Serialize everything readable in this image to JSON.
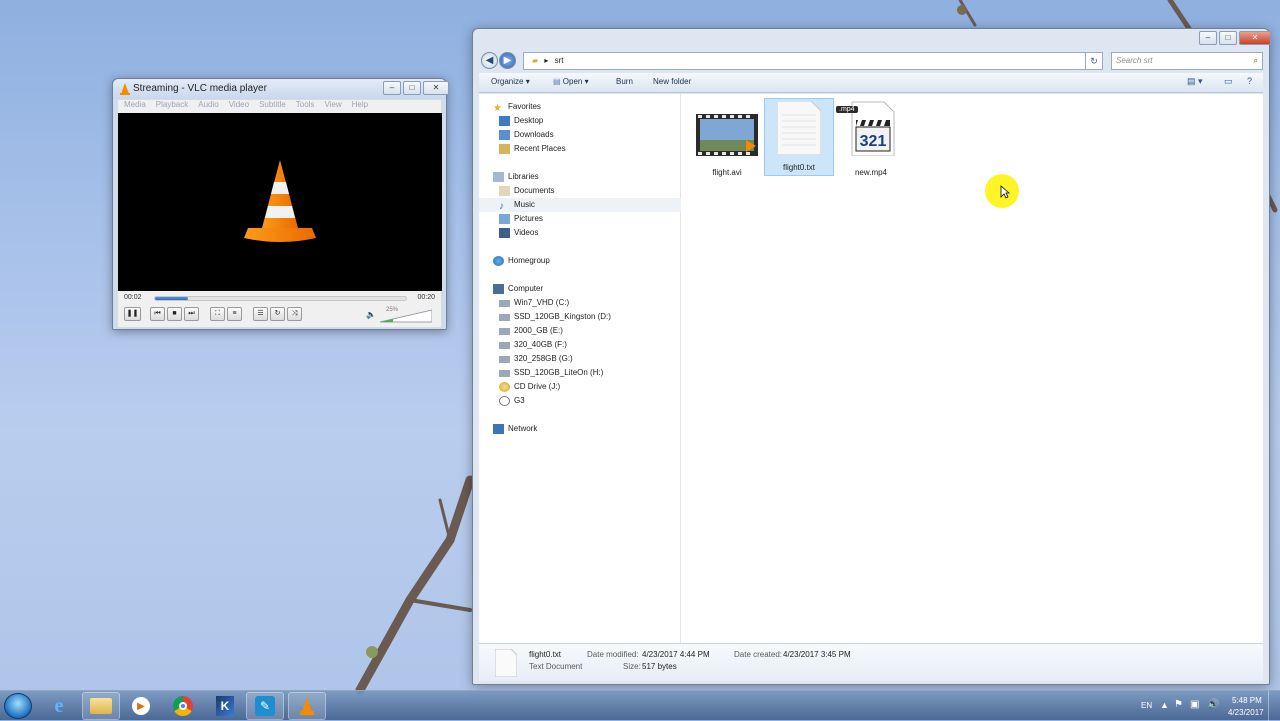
{
  "vlc": {
    "title": "Streaming - VLC media player",
    "menu": [
      "Media",
      "Playback",
      "Audio",
      "Video",
      "Subtitle",
      "Tools",
      "View",
      "Help"
    ],
    "elapsed": "00:02",
    "duration": "00:20",
    "progress": 0.13,
    "volume_label": "25%",
    "volume": 0.25
  },
  "explorer": {
    "breadcrumb": "srt",
    "search_placeholder": "Search srt",
    "toolbar": {
      "organize": "Organize",
      "open": "Open",
      "burn": "Burn",
      "new_folder": "New folder"
    },
    "nav": {
      "favorites": "Favorites",
      "favorites_items": [
        "Desktop",
        "Downloads",
        "Recent Places"
      ],
      "libraries": "Libraries",
      "libraries_items": [
        "Documents",
        "Music",
        "Pictures",
        "Videos"
      ],
      "homegroup": "Homegroup",
      "computer": "Computer",
      "computer_items": [
        "Win7_VHD (C:)",
        "SSD_120GB_Kingston (D:)",
        "2000_GB (E:)",
        "320_40GB (F:)",
        "320_258GB (G:)",
        "SSD_120GB_LiteOn (H:)",
        "CD Drive (J:)",
        "G3"
      ],
      "network": "Network"
    },
    "files": [
      {
        "name": "flight.avi",
        "icon": "video-thumbnail-icon"
      },
      {
        "name": "flight0.txt",
        "icon": "text-document-icon"
      },
      {
        "name": "new.mp4",
        "icon": "mp4-clapper-icon",
        "badge": ".mp4"
      }
    ],
    "details": {
      "name": "flight0.txt",
      "type": "Text Document",
      "modified_label": "Date modified:",
      "modified": "4/23/2017 4:44 PM",
      "size_label": "Size:",
      "size": "517 bytes",
      "created_label": "Date created:",
      "created": "4/23/2017 3:45 PM"
    }
  },
  "taskbar": {
    "apps": [
      "windows-start-icon",
      "internet-explorer-icon",
      "file-explorer-icon",
      "media-player-icon",
      "chrome-icon",
      "app-icon",
      "tool-icon",
      "vlc-icon"
    ],
    "language": "EN",
    "time": "5:48 PM",
    "date": "4/23/2017"
  }
}
